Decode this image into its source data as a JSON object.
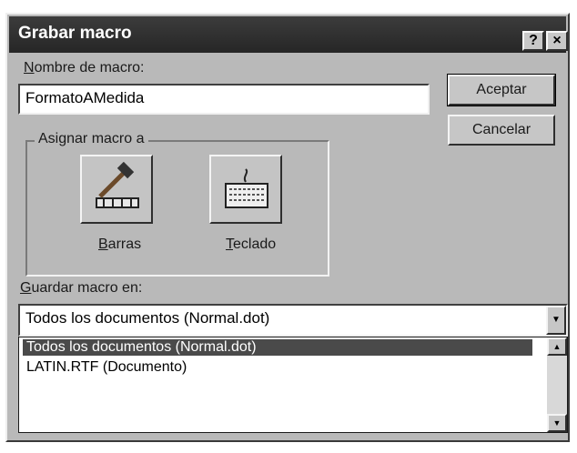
{
  "window": {
    "title": "Grabar macro",
    "help_label": "?",
    "close_label": "×"
  },
  "name_field": {
    "label_first": "N",
    "label_rest": "ombre de macro:",
    "value": "FormatoAMedida"
  },
  "buttons": {
    "accept": "Aceptar",
    "cancel": "Cancelar"
  },
  "assign_group": {
    "label": "Asignar macro a",
    "bars_first": "B",
    "bars_rest": "arras",
    "keyboard_first": "T",
    "keyboard_rest": "eclado",
    "bars_icon": "hammer-toolbar-icon",
    "keyboard_icon": "keyboard-icon"
  },
  "save_in": {
    "label_first": "G",
    "label_rest": "uardar macro en:",
    "selected": "Todos los documentos (Normal.dot)",
    "options": [
      "Todos los documentos (Normal.dot)",
      "LATIN.RTF (Documento)"
    ]
  },
  "colors": {
    "titlebar": "#262626",
    "dialog_face": "#b9b9b9",
    "selection": "#4a4a4a"
  }
}
